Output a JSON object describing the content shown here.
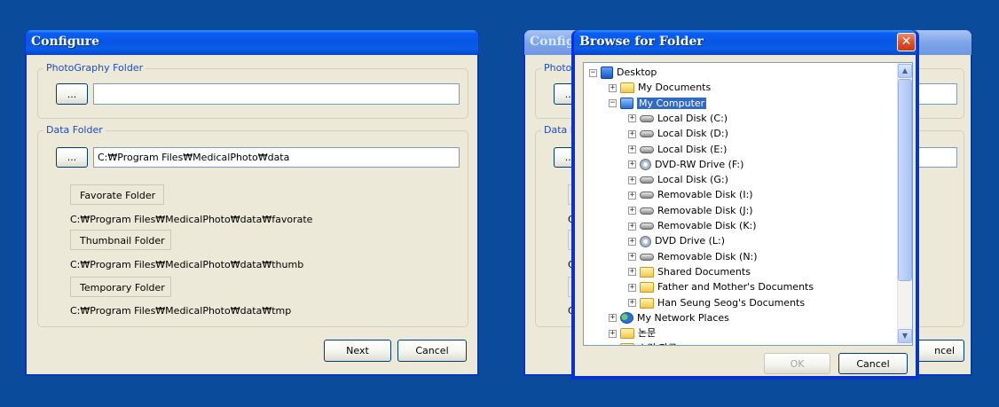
{
  "configure": {
    "title": "Configure",
    "photo_group": {
      "legend": "PhotoGraphy Folder",
      "browse_label": "...",
      "path": ""
    },
    "data_group": {
      "legend": "Data Folder",
      "browse_label": "...",
      "path": "C:₩Program Files₩MedicalPhoto₩data",
      "favorite_label": "Favorate Folder",
      "favorite_path": "C:₩Program Files₩MedicalPhoto₩data₩favorate",
      "thumbnail_label": "Thumbnail Folder",
      "thumbnail_path": "C:₩Program Files₩MedicalPhoto₩data₩thumb",
      "temporary_label": "Temporary Folder",
      "temporary_path": "C:₩Program Files₩MedicalPhoto₩data₩tmp"
    },
    "next_label": "Next",
    "cancel_label": "Cancel"
  },
  "configure_bg": {
    "title": "Configu",
    "photo_legend": "PhotoG",
    "browse_label": "...",
    "data_legend": "Data F",
    "c_label": "C",
    "cancel_label": "ncel"
  },
  "browse": {
    "title": "Browse for Folder",
    "close_label": "✕",
    "tree": [
      {
        "label": "Desktop",
        "icon": "desktop-icon",
        "expander": "−"
      },
      {
        "label": "My Documents",
        "icon": "folder-icon",
        "expander": "+"
      },
      {
        "label": "My Computer",
        "icon": "computer-icon",
        "expander": "−",
        "selected": true
      },
      {
        "label": "Local Disk (C:)",
        "icon": "hard-disk-icon",
        "expander": "+"
      },
      {
        "label": "Local Disk (D:)",
        "icon": "hard-disk-icon",
        "expander": "+"
      },
      {
        "label": "Local Disk (E:)",
        "icon": "hard-disk-icon",
        "expander": "+"
      },
      {
        "label": "DVD-RW Drive (F:)",
        "icon": "dvd-drive-icon",
        "expander": "+"
      },
      {
        "label": "Local Disk (G:)",
        "icon": "hard-disk-icon",
        "expander": "+"
      },
      {
        "label": "Removable Disk (I:)",
        "icon": "removable-disk-icon",
        "expander": "+"
      },
      {
        "label": "Removable Disk (J:)",
        "icon": "removable-disk-icon",
        "expander": "+"
      },
      {
        "label": "Removable Disk (K:)",
        "icon": "removable-disk-icon",
        "expander": "+"
      },
      {
        "label": "DVD Drive (L:)",
        "icon": "dvd-drive-icon",
        "expander": "+"
      },
      {
        "label": "Removable Disk (N:)",
        "icon": "removable-disk-icon",
        "expander": "+"
      },
      {
        "label": "Shared Documents",
        "icon": "folder-icon",
        "expander": "+"
      },
      {
        "label": "Father and Mother's Documents",
        "icon": "folder-icon",
        "expander": "+"
      },
      {
        "label": "Han Seung Seog's Documents",
        "icon": "folder-icon",
        "expander": "+"
      },
      {
        "label": "My Network Places",
        "icon": "network-icon",
        "expander": "+"
      },
      {
        "label": "논문",
        "icon": "folder-icon",
        "expander": "+"
      },
      {
        "label": "스킨 자료",
        "icon": "folder-icon",
        "expander": "+"
      }
    ],
    "ok_label": "OK",
    "cancel_label": "Cancel",
    "scroll_up": "▲",
    "scroll_down": "▼"
  }
}
